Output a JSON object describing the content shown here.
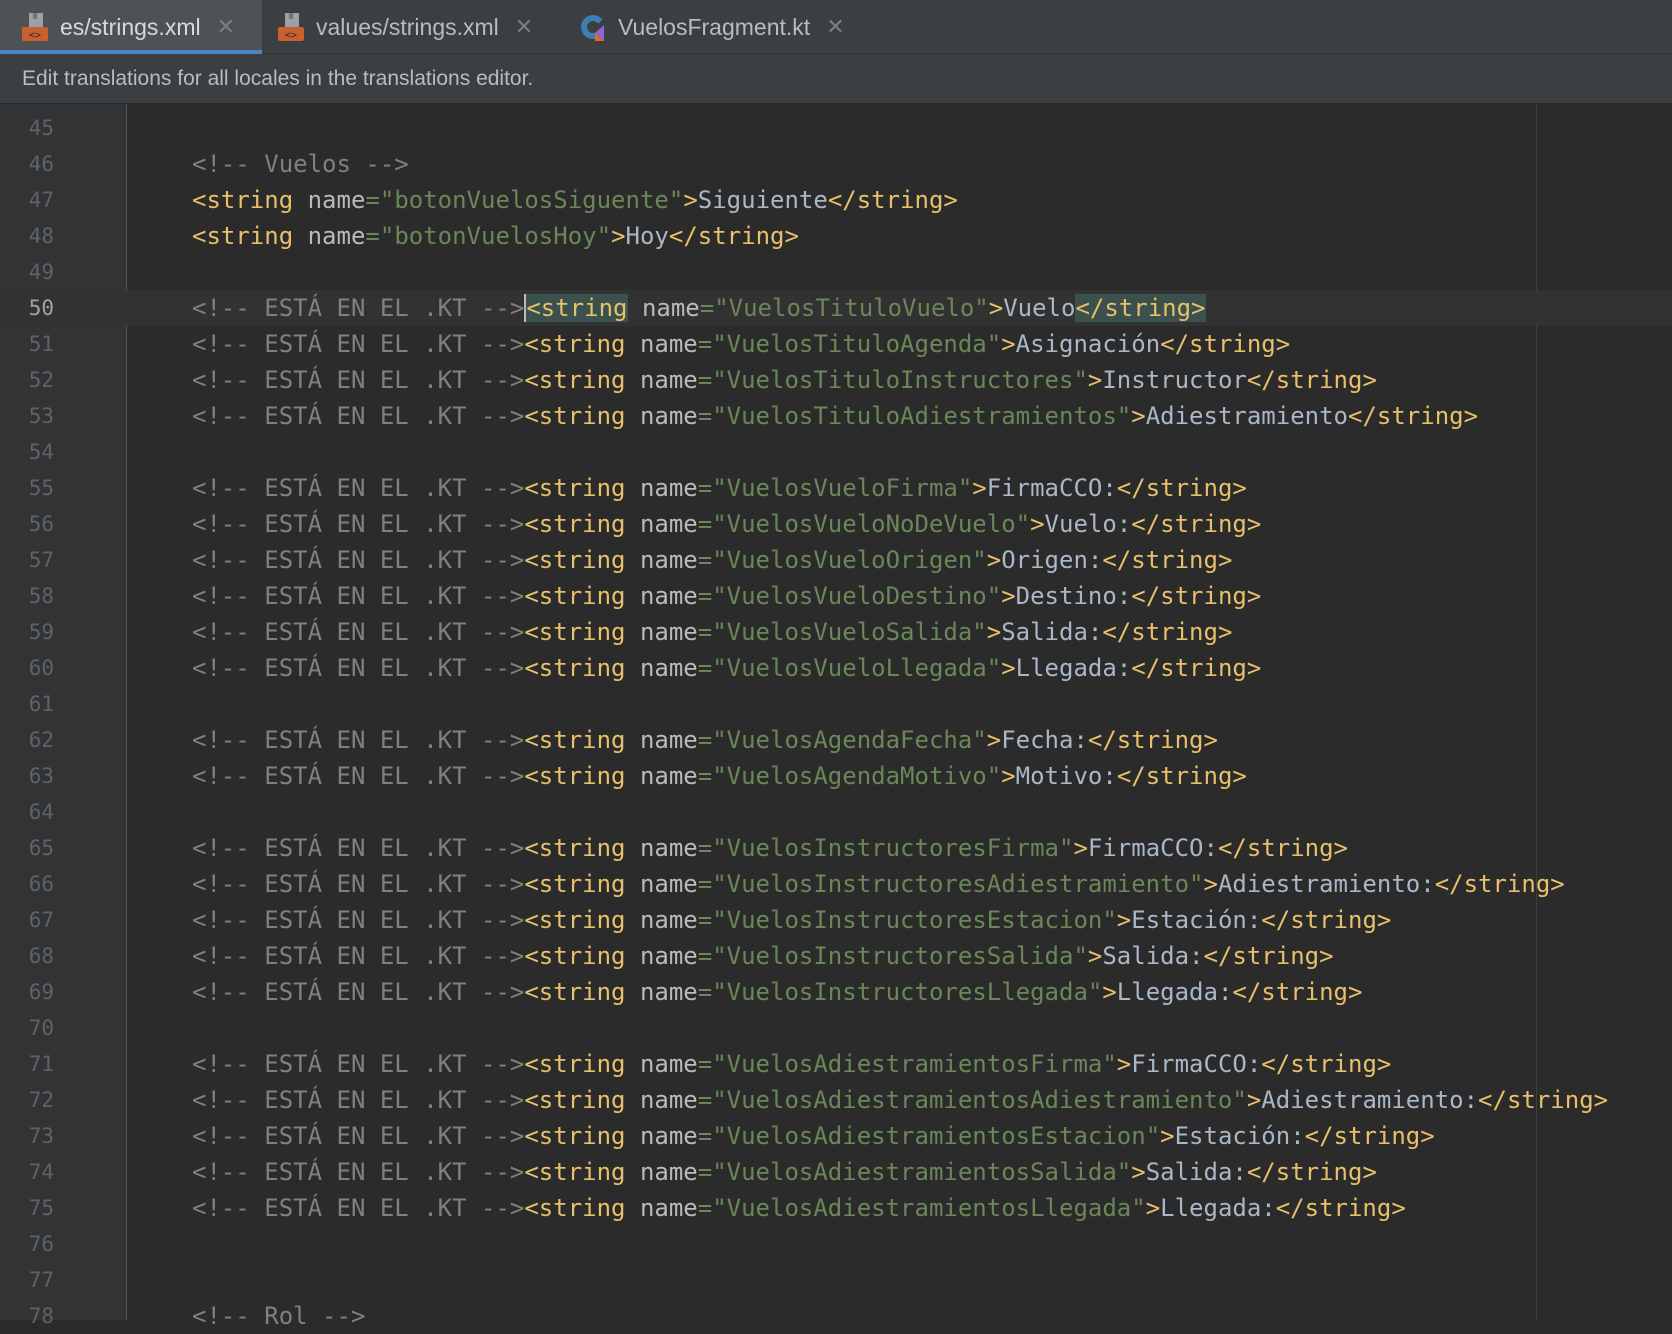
{
  "tabs": [
    {
      "label": "es/strings.xml",
      "icon": "xml-file-icon",
      "active": true
    },
    {
      "label": "values/strings.xml",
      "icon": "xml-file-icon",
      "active": false
    },
    {
      "label": "VuelosFragment.kt",
      "icon": "kotlin-file-icon",
      "active": false
    }
  ],
  "close_glyph": "✕",
  "banner": {
    "text": "Edit translations for all locales in the translations editor."
  },
  "editor": {
    "current_line": 50,
    "comment_prefix": "<!-- ESTÁ EN EL .KT -->",
    "lines": [
      {
        "n": "45",
        "kind": "blank"
      },
      {
        "n": "46",
        "kind": "comment",
        "text": "<!-- Vuelos -->"
      },
      {
        "n": "47",
        "kind": "string",
        "prefix": false,
        "name": "botonVuelosSiguente",
        "value": "Siguiente"
      },
      {
        "n": "48",
        "kind": "string",
        "prefix": false,
        "name": "botonVuelosHoy",
        "value": "Hoy"
      },
      {
        "n": "49",
        "kind": "blank"
      },
      {
        "n": "50",
        "kind": "string",
        "prefix": true,
        "name": "VuelosTituloVuelo",
        "value": "Vuelo"
      },
      {
        "n": "51",
        "kind": "string",
        "prefix": true,
        "name": "VuelosTituloAgenda",
        "value": "Asignación"
      },
      {
        "n": "52",
        "kind": "string",
        "prefix": true,
        "name": "VuelosTituloInstructores",
        "value": "Instructor"
      },
      {
        "n": "53",
        "kind": "string",
        "prefix": true,
        "name": "VuelosTituloAdiestramientos",
        "value": "Adiestramiento"
      },
      {
        "n": "54",
        "kind": "blank"
      },
      {
        "n": "55",
        "kind": "string",
        "prefix": true,
        "name": "VuelosVueloFirma",
        "value": "FirmaCCO:"
      },
      {
        "n": "56",
        "kind": "string",
        "prefix": true,
        "name": "VuelosVueloNoDeVuelo",
        "value": "Vuelo:"
      },
      {
        "n": "57",
        "kind": "string",
        "prefix": true,
        "name": "VuelosVueloOrigen",
        "value": "Origen:"
      },
      {
        "n": "58",
        "kind": "string",
        "prefix": true,
        "name": "VuelosVueloDestino",
        "value": "Destino:"
      },
      {
        "n": "59",
        "kind": "string",
        "prefix": true,
        "name": "VuelosVueloSalida",
        "value": "Salida:"
      },
      {
        "n": "60",
        "kind": "string",
        "prefix": true,
        "name": "VuelosVueloLlegada",
        "value": "Llegada:"
      },
      {
        "n": "61",
        "kind": "blank"
      },
      {
        "n": "62",
        "kind": "string",
        "prefix": true,
        "name": "VuelosAgendaFecha",
        "value": "Fecha:"
      },
      {
        "n": "63",
        "kind": "string",
        "prefix": true,
        "name": "VuelosAgendaMotivo",
        "value": "Motivo:"
      },
      {
        "n": "64",
        "kind": "blank"
      },
      {
        "n": "65",
        "kind": "string",
        "prefix": true,
        "name": "VuelosInstructoresFirma",
        "value": "FirmaCCO:"
      },
      {
        "n": "66",
        "kind": "string",
        "prefix": true,
        "name": "VuelosInstructoresAdiestramiento",
        "value": "Adiestramiento:"
      },
      {
        "n": "67",
        "kind": "string",
        "prefix": true,
        "name": "VuelosInstructoresEstacion",
        "value": "Estación:"
      },
      {
        "n": "68",
        "kind": "string",
        "prefix": true,
        "name": "VuelosInstructoresSalida",
        "value": "Salida:"
      },
      {
        "n": "69",
        "kind": "string",
        "prefix": true,
        "name": "VuelosInstructoresLlegada",
        "value": "Llegada:"
      },
      {
        "n": "70",
        "kind": "blank"
      },
      {
        "n": "71",
        "kind": "string",
        "prefix": true,
        "name": "VuelosAdiestramientosFirma",
        "value": "FirmaCCO:"
      },
      {
        "n": "72",
        "kind": "string",
        "prefix": true,
        "name": "VuelosAdiestramientosAdiestramiento",
        "value": "Adiestramiento:"
      },
      {
        "n": "73",
        "kind": "string",
        "prefix": true,
        "name": "VuelosAdiestramientosEstacion",
        "value": "Estación:"
      },
      {
        "n": "74",
        "kind": "string",
        "prefix": true,
        "name": "VuelosAdiestramientosSalida",
        "value": "Salida:"
      },
      {
        "n": "75",
        "kind": "string",
        "prefix": true,
        "name": "VuelosAdiestramientosLlegada",
        "value": "Llegada:"
      },
      {
        "n": "76",
        "kind": "blank"
      },
      {
        "n": "77",
        "kind": "blank"
      },
      {
        "n": "78",
        "kind": "comment",
        "text": "<!-- Rol -->"
      }
    ]
  },
  "colors": {
    "background": "#2b2b2b",
    "gutter": "#313335",
    "comment": "#808080",
    "tag": "#e8bf6a",
    "attribute": "#bababa",
    "attribute_value": "#6a8759",
    "text": "#a9b7c6",
    "active_tab_underline": "#4a88c7"
  }
}
